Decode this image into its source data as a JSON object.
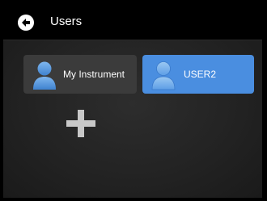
{
  "header": {
    "back_icon": "arrow-left-circle-icon",
    "title": "Users"
  },
  "users": [
    {
      "label": "My Instrument",
      "icon": "user-avatar-icon",
      "selected": false
    },
    {
      "label": "USER2",
      "icon": "user-avatar-icon",
      "selected": true
    }
  ],
  "add_user": {
    "icon": "plus-icon"
  },
  "colors": {
    "selected_tile": "#4a8ee0",
    "tile": "#3b3b3b",
    "background": "#232323",
    "avatar": "#4a90d9"
  }
}
